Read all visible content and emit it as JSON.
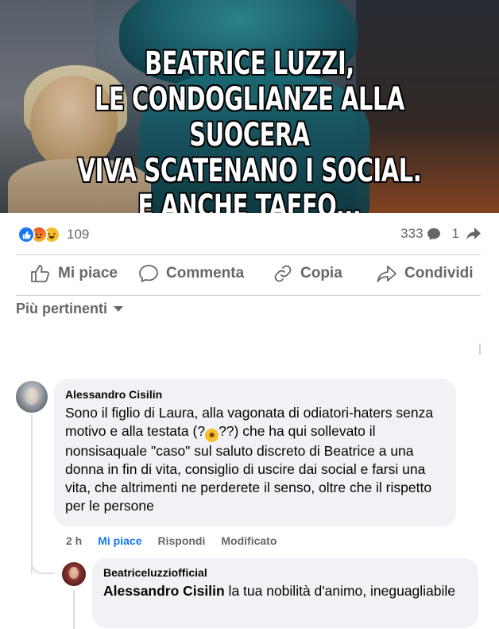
{
  "post": {
    "headline_lines": [
      "BEATRICE LUZZI,",
      "LE CONDOGLIANZE ALLA SUOCERA",
      "VIVA SCATENANO I SOCIAL.",
      "E ANCHE TAFFO..."
    ],
    "reaction_count": "109",
    "comment_count": "333",
    "share_count": "1"
  },
  "actions": {
    "like": "Mi piace",
    "comment": "Commenta",
    "copy": "Copia",
    "share": "Condividi"
  },
  "sort": {
    "label": "Più pertinenti"
  },
  "comments": [
    {
      "author": "Alessandro Cisilin",
      "text_before_emoji": "Sono il figlio di Laura, alla vagonata di odiatori-haters senza motivo e alla testata (?",
      "text_after_emoji": "??) che ha qui sollevato il nonsisaquale \"caso\" sul saluto discreto di Beatrice a una donna in fin di vita, consiglio di uscire dai social e farsi una vita, che altrimenti ne perderete il senso, oltre che il rispetto per le persone",
      "time": "2 h",
      "like_label": "Mi piace",
      "reply_label": "Rispondi",
      "edited_label": "Modificato"
    },
    {
      "author": "Beatriceluzziofficial",
      "mention": "Alessandro Cisilin",
      "text": " la tua nobilità d'animo, ineguagliabile"
    }
  ],
  "colors": {
    "accent": "#1877f2",
    "secondary_text": "#65676b",
    "bubble_bg": "#f0f2f5"
  }
}
